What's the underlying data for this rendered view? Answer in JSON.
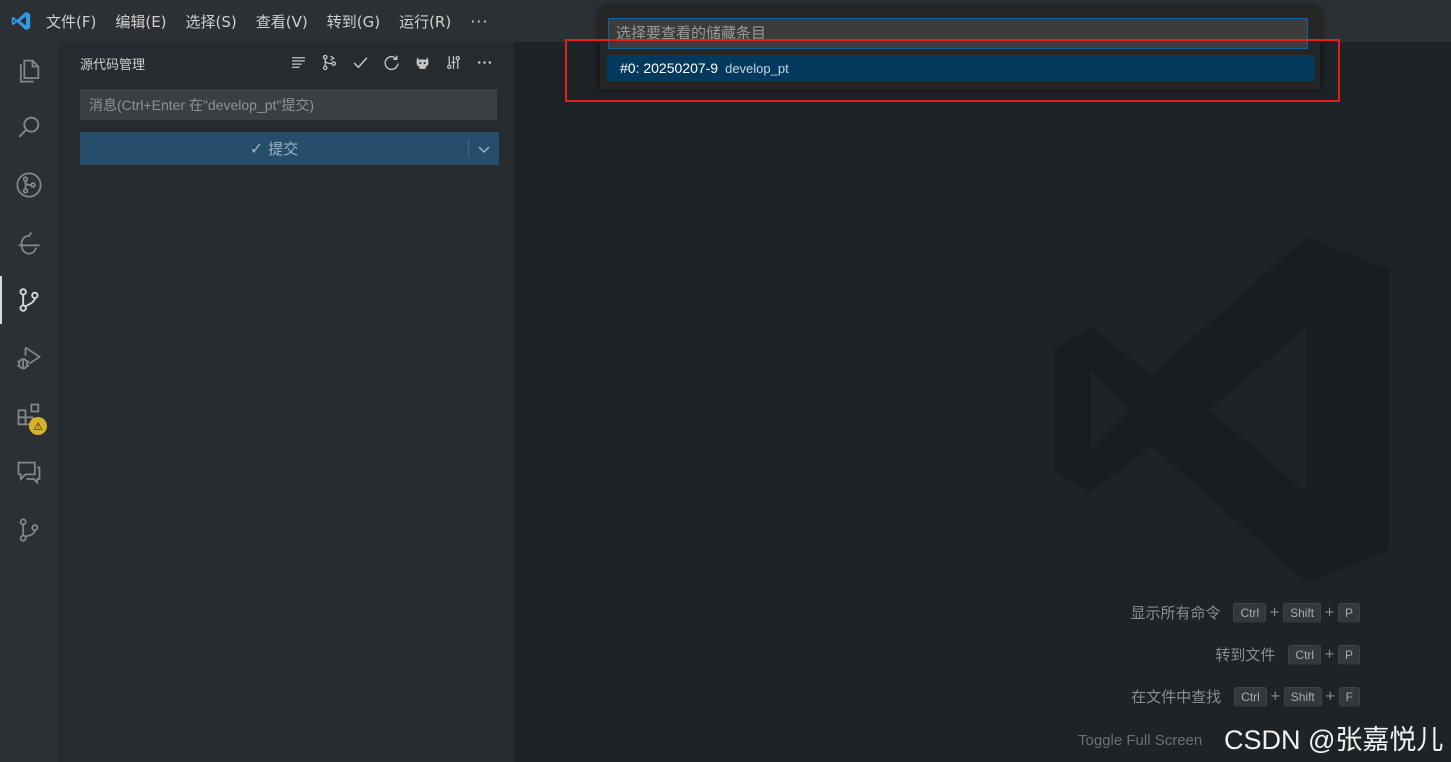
{
  "menubar": {
    "items": [
      "文件(F)",
      "编辑(E)",
      "选择(S)",
      "查看(V)",
      "转到(G)",
      "运行(R)"
    ],
    "more": "···"
  },
  "activitybar": {
    "icons": [
      "explorer-icon",
      "search-icon",
      "gitlens-icon",
      "remote-explorer-icon",
      "source-control-icon",
      "run-debug-icon",
      "extensions-icon",
      "comments-icon",
      "git-graph-icon"
    ],
    "warning_badge": "⚠"
  },
  "sidebar": {
    "title": "源代码管理",
    "toolbar_icons": [
      "view-as-list-icon",
      "branch-compare-icon",
      "commit-check-icon",
      "refresh-icon",
      "github-icon",
      "stash-icon",
      "more-actions-icon"
    ],
    "commit_placeholder": "消息(Ctrl+Enter 在\"develop_pt\"提交)",
    "commit_button": "提交"
  },
  "quickpick": {
    "placeholder": "选择要查看的储藏条目",
    "items": [
      {
        "label": "#0: 20250207-9",
        "description": "develop_pt"
      }
    ]
  },
  "shortcuts": [
    {
      "label": "显示所有命令",
      "keys": [
        "Ctrl",
        "Shift",
        "P"
      ]
    },
    {
      "label": "转到文件",
      "keys": [
        "Ctrl",
        "P"
      ]
    },
    {
      "label": "在文件中查找",
      "keys": [
        "Ctrl",
        "Shift",
        "F"
      ]
    }
  ],
  "toggle_full_screen": "Toggle Full Screen",
  "watermark_text": "CSDN @张嘉悦儿",
  "colors": {
    "accent": "#007acc",
    "highlight_border": "#e0201d",
    "selection": "#04395e",
    "commit_button": "#264d6a"
  }
}
